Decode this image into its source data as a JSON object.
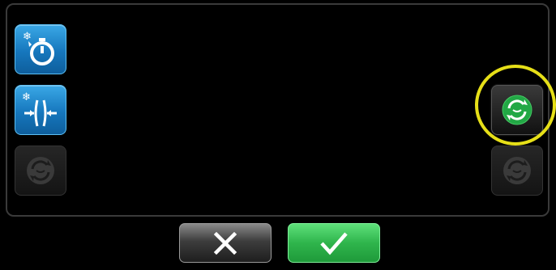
{
  "screen": {
    "background": "#000000",
    "panel_border_color": "#3a3a3a"
  },
  "left_column": {
    "items": [
      {
        "icon": "defrost-timer-icon",
        "state": "active",
        "color": "#1677bd"
      },
      {
        "icon": "defrost-compress-icon",
        "state": "active",
        "color": "#1677bd"
      },
      {
        "icon": "cycle-icon",
        "state": "disabled"
      }
    ]
  },
  "right_column": {
    "items": [
      {
        "icon": "cycle-icon",
        "state": "highlighted",
        "color": "#22a845"
      },
      {
        "icon": "cycle-icon",
        "state": "disabled"
      }
    ],
    "highlight_color": "#e6df18"
  },
  "footer": {
    "cancel": {
      "icon": "close-icon",
      "glyph": "✕"
    },
    "confirm": {
      "icon": "check-icon",
      "glyph": "✓",
      "color": "#2fb54c"
    }
  }
}
